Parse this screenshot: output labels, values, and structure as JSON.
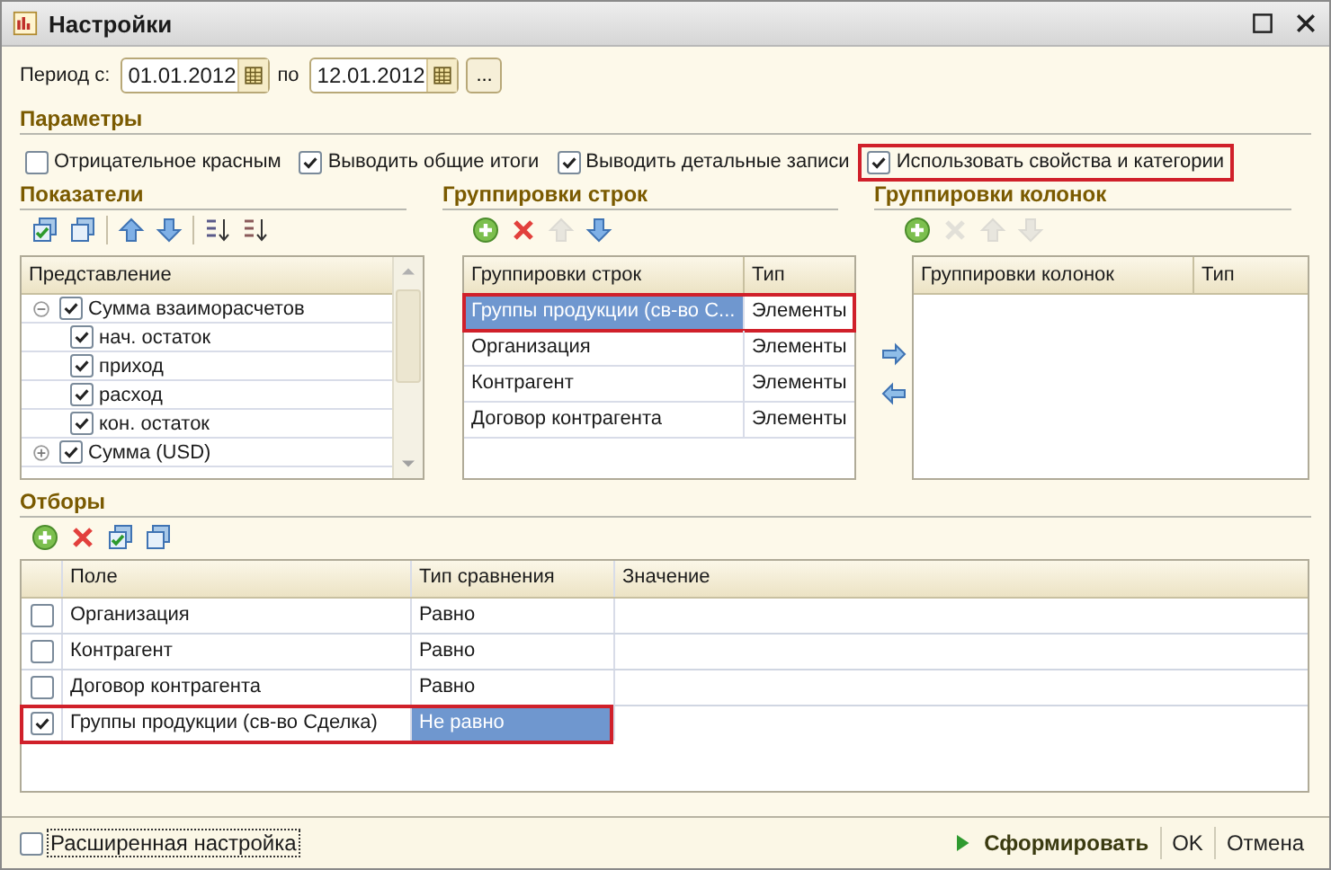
{
  "window": {
    "title": "Настройки"
  },
  "period": {
    "label": "Период с:",
    "from": "01.01.2012",
    "to_label": "по",
    "to": "12.01.2012",
    "more_button": "..."
  },
  "parameters": {
    "heading": "Параметры",
    "options": [
      {
        "label": "Отрицательное красным",
        "checked": false,
        "highlighted": false
      },
      {
        "label": "Выводить общие итоги",
        "checked": true,
        "highlighted": false
      },
      {
        "label": "Выводить детальные записи",
        "checked": true,
        "highlighted": false
      },
      {
        "label": "Использовать свойства и категории",
        "checked": true,
        "highlighted": true
      }
    ]
  },
  "indicators": {
    "heading": "Показатели",
    "toolbar": [
      {
        "kind": "check-all",
        "disabled": false
      },
      {
        "kind": "uncheck-all",
        "disabled": false
      },
      {
        "kind": "sep"
      },
      {
        "kind": "up",
        "disabled": false
      },
      {
        "kind": "down",
        "disabled": false
      },
      {
        "kind": "sep"
      },
      {
        "kind": "sort-asc",
        "disabled": false
      },
      {
        "kind": "sort-desc",
        "disabled": false
      }
    ],
    "column": "Представление",
    "items": [
      {
        "label": "Сумма взаиморасчетов",
        "checked": true,
        "expanded": true,
        "children": [
          {
            "label": "нач. остаток",
            "checked": true
          },
          {
            "label": "приход",
            "checked": true
          },
          {
            "label": "расход",
            "checked": true
          },
          {
            "label": "кон. остаток",
            "checked": true
          }
        ]
      },
      {
        "label": "Сумма (USD)",
        "checked": true,
        "expanded": false
      }
    ]
  },
  "row_groupings": {
    "heading": "Группировки строк",
    "toolbar": [
      {
        "kind": "add",
        "disabled": false
      },
      {
        "kind": "delete",
        "disabled": false
      },
      {
        "kind": "up",
        "disabled": true
      },
      {
        "kind": "down",
        "disabled": false
      }
    ],
    "columns": [
      "Группировки строк",
      "Тип"
    ],
    "rows": [
      {
        "cells": [
          "Группы продукции (св-во С...",
          "Элементы"
        ],
        "selected": true,
        "highlighted": true
      },
      {
        "cells": [
          "Организация",
          "Элементы"
        ],
        "selected": false,
        "highlighted": false
      },
      {
        "cells": [
          "Контрагент",
          "Элементы"
        ],
        "selected": false,
        "highlighted": false
      },
      {
        "cells": [
          "Договор контрагента",
          "Элементы"
        ],
        "selected": false,
        "highlighted": false
      }
    ]
  },
  "column_groupings": {
    "heading": "Группировки колонок",
    "toolbar": [
      {
        "kind": "add",
        "disabled": false
      },
      {
        "kind": "delete",
        "disabled": true
      },
      {
        "kind": "up",
        "disabled": true
      },
      {
        "kind": "down",
        "disabled": true
      }
    ],
    "columns": [
      "Группировки колонок",
      "Тип"
    ]
  },
  "filters": {
    "heading": "Отборы",
    "toolbar": [
      {
        "kind": "add",
        "disabled": false
      },
      {
        "kind": "delete",
        "disabled": false
      },
      {
        "kind": "check-all",
        "disabled": false
      },
      {
        "kind": "uncheck-all",
        "disabled": false
      }
    ],
    "columns": [
      "Поле",
      "Тип сравнения",
      "Значение"
    ],
    "rows": [
      {
        "checked": false,
        "field": "Организация",
        "comparison": "Равно",
        "selected": false,
        "highlighted": false
      },
      {
        "checked": false,
        "field": "Контрагент",
        "comparison": "Равно",
        "selected": false,
        "highlighted": false
      },
      {
        "checked": false,
        "field": "Договор контрагента",
        "comparison": "Равно",
        "selected": false,
        "highlighted": false
      },
      {
        "checked": true,
        "field": "Группы продукции (св-во Сделка)",
        "comparison": "Не равно",
        "selected": true,
        "highlighted": true
      }
    ]
  },
  "footer": {
    "advanced": {
      "label": "Расширенная настройка",
      "checked": false
    },
    "buttons": [
      {
        "label": "Сформировать",
        "kind": "primary"
      },
      {
        "label": "OK",
        "kind": "plain"
      },
      {
        "label": "Отмена",
        "kind": "plain"
      }
    ]
  }
}
